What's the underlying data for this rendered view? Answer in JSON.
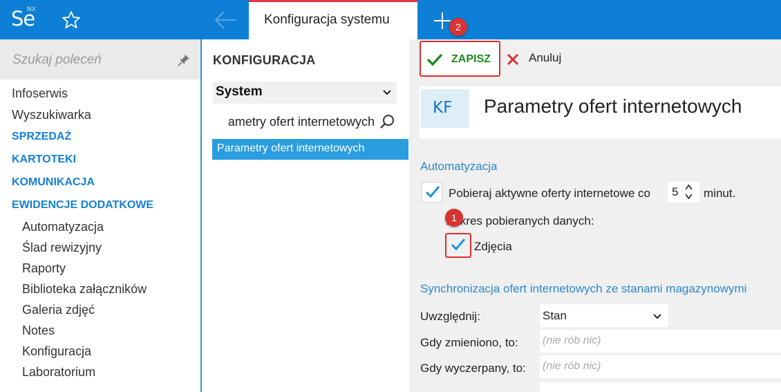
{
  "topbar": {
    "logo_text": "Se",
    "logo_super": "NX",
    "tab_title": "Konfiguracja systemu",
    "star_icon": "star-icon",
    "back_icon": "arrow-left-icon",
    "plus_icon": "plus-icon",
    "accent_color": "#0e7fd6",
    "active_tab_border": "#e1363f"
  },
  "sidebar": {
    "search_placeholder": "Szukaj poleceń",
    "pin_icon": "pin-icon",
    "items": [
      {
        "label": "Infoserwis",
        "type": "item"
      },
      {
        "label": "Wyszukiwarka",
        "type": "item"
      },
      {
        "label": "SPRZEDAŻ",
        "type": "section"
      },
      {
        "label": "KARTOTEKI",
        "type": "section"
      },
      {
        "label": "KOMUNIKACJA",
        "type": "section"
      },
      {
        "label": "EWIDENCJE DODATKOWE",
        "type": "section"
      },
      {
        "label": "Automatyzacja",
        "type": "sub"
      },
      {
        "label": "Ślad rewizyjny",
        "type": "sub"
      },
      {
        "label": "Raporty",
        "type": "sub"
      },
      {
        "label": "Biblioteka załączników",
        "type": "sub"
      },
      {
        "label": "Galeria zdjęć",
        "type": "sub"
      },
      {
        "label": "Notes",
        "type": "sub"
      },
      {
        "label": "Konfiguracja",
        "type": "sub"
      },
      {
        "label": "Laboratorium",
        "type": "sub"
      }
    ]
  },
  "middle": {
    "title": "KONFIGURACJA",
    "select_value": "System",
    "search_value": "ametry ofert internetowych",
    "list_item": "Parametry ofert internetowych"
  },
  "toolbar": {
    "save_label": "ZAPISZ",
    "cancel_label": "Anuluj"
  },
  "header": {
    "badge": "KF",
    "title": "Parametry ofert internetowych"
  },
  "automation": {
    "heading": "Automatyzacja",
    "fetch_label": "Pobieraj aktywne oferty internetowe co",
    "fetch_checked": true,
    "interval_value": "5",
    "interval_unit": "minut.",
    "range_label": "Zakres pobieranych danych:",
    "photos_label": "Zdjęcia",
    "photos_checked": true
  },
  "sync": {
    "heading": "Synchronizacja ofert internetowych ze stanami magazynowymi",
    "include_label": "Uwzględnij:",
    "include_value": "Stan",
    "changed_label": "Gdy zmieniono, to:",
    "changed_value": "(nie rób nic)",
    "exhausted_label": "Gdy wyczerpany, to:",
    "exhausted_value": "(nie rób nic)"
  },
  "markers": {
    "one": "1",
    "two": "2"
  }
}
